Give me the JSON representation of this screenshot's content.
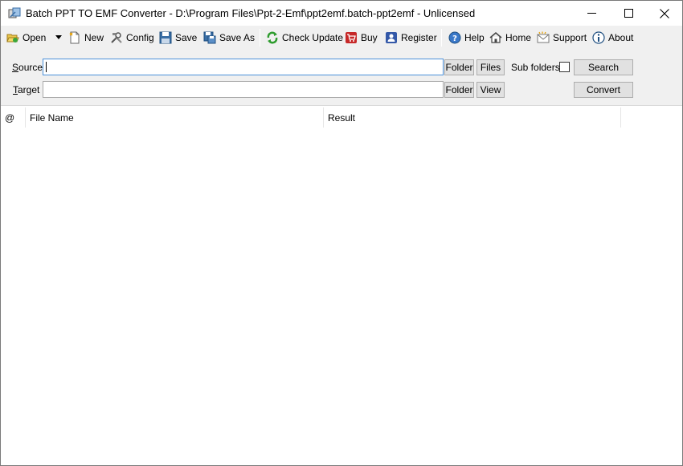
{
  "window": {
    "title": "Batch PPT TO EMF Converter - D:\\Program Files\\Ppt-2-Emf\\ppt2emf.batch-ppt2emf - Unlicensed",
    "icon": "converter-app-icon",
    "controls": {
      "minimize": "minimize-icon",
      "maximize": "maximize-icon",
      "close": "close-icon"
    }
  },
  "toolbar": {
    "open": "Open",
    "new": "New",
    "config": "Config",
    "save": "Save",
    "save_as": "Save As",
    "check_update": "Check Update",
    "buy": "Buy",
    "register": "Register",
    "help": "Help",
    "home": "Home",
    "support": "Support",
    "about": "About"
  },
  "options": {
    "source_label_key": "S",
    "source_label_rest": "ource",
    "source_value": "",
    "target_label_key": "T",
    "target_label_rest": "arget",
    "target_value": "",
    "source_folder_btn": "Folder",
    "source_files_btn": "Files",
    "subfolders_label": "Sub folders",
    "subfolders_checked": false,
    "search_btn": "Search",
    "target_folder_btn": "Folder",
    "target_view_btn": "View",
    "convert_btn": "Convert"
  },
  "list": {
    "columns": [
      "@",
      "File Name",
      "Result"
    ],
    "rows": []
  },
  "colors": {
    "toolbar_bg": "#f0f0f0",
    "focus_border": "#4a90d9",
    "button_bg": "#e1e1e1"
  }
}
